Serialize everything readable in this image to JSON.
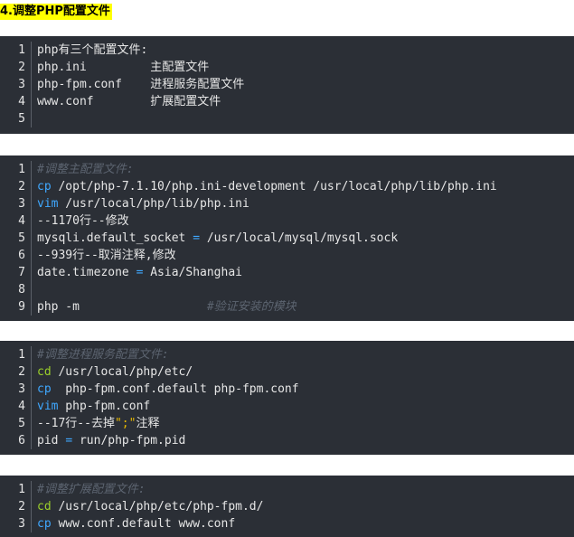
{
  "heading": "4.调整PHP配置文件",
  "block1": {
    "lines": [
      {
        "n": "1",
        "text": "php有三个配置文件:"
      },
      {
        "n": "2",
        "text": "php.ini         主配置文件"
      },
      {
        "n": "3",
        "text": "php-fpm.conf    进程服务配置文件"
      },
      {
        "n": "4",
        "text": "www.conf        扩展配置文件"
      },
      {
        "n": "5",
        "text": ""
      }
    ]
  },
  "block2": {
    "lines": [
      {
        "n": "1",
        "comment": "#调整主配置文件:"
      },
      {
        "n": "2",
        "cmd": "cp",
        "rest": " /opt/php-7.1.10/php.ini-development /usr/local/php/lib/php.ini"
      },
      {
        "n": "3",
        "cmd": "vim",
        "rest": " /usr/local/php/lib/php.ini"
      },
      {
        "n": "4",
        "text": "--1170行--修改"
      },
      {
        "n": "5",
        "pre": "mysqli.default_socket ",
        "op": "=",
        "post": " /usr/local/mysql/mysql.sock"
      },
      {
        "n": "6",
        "text": "--939行--取消注释,修改"
      },
      {
        "n": "7",
        "pre": "date.timezone ",
        "op": "=",
        "post": " Asia/Shanghai"
      },
      {
        "n": "8",
        "text": ""
      },
      {
        "n": "9",
        "text": "php -m                  ",
        "comment": "#验证安装的模块"
      }
    ]
  },
  "block3": {
    "lines": [
      {
        "n": "1",
        "comment": "#调整进程服务配置文件:"
      },
      {
        "n": "2",
        "cmd": "cd",
        "rest": " /usr/local/php/etc/"
      },
      {
        "n": "3",
        "cmd": "cp",
        "rest": "  php-fpm.conf.default php-fpm.conf"
      },
      {
        "n": "4",
        "cmd": "vim",
        "rest": " php-fpm.conf"
      },
      {
        "n": "5",
        "pre": "--17行--去掉",
        "str": "\";\"",
        "post": "注释"
      },
      {
        "n": "6",
        "pre": "pid ",
        "op": "=",
        "post": " run/php-fpm.pid"
      }
    ]
  },
  "block4": {
    "lines": [
      {
        "n": "1",
        "comment": "#调整扩展配置文件:"
      },
      {
        "n": "2",
        "cmd": "cd",
        "rest": " /usr/local/php/etc/php-fpm.d/"
      },
      {
        "n": "3",
        "cmd": "cp",
        "rest": " www.conf.default www.conf"
      }
    ]
  }
}
